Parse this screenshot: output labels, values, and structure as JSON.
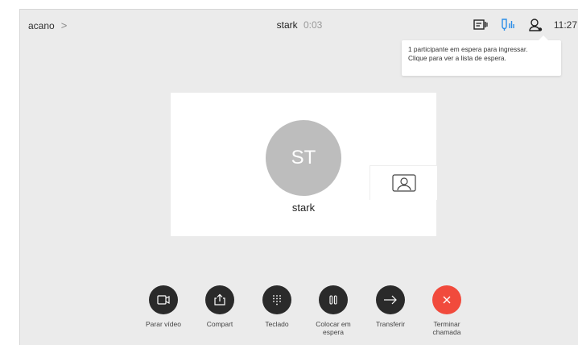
{
  "header": {
    "breadcrumb": "acano",
    "breadcrumb_chevron": ">",
    "caller": "stark",
    "duration": "0:03",
    "time": "11:27"
  },
  "tooltip": {
    "line1": "1 participante em espera para ingressar.",
    "line2": "Clique para ver a lista de espera."
  },
  "call": {
    "initials": "ST",
    "name": "stark"
  },
  "controls": [
    {
      "label": "Parar vídeo",
      "icon": "video-icon"
    },
    {
      "label": "Compart",
      "icon": "share-icon"
    },
    {
      "label": "Teclado",
      "icon": "keypad-icon"
    },
    {
      "label": "Colocar em espera",
      "icon": "pause-icon"
    },
    {
      "label": "Transferir",
      "icon": "arrow-right-icon"
    },
    {
      "label": "Terminar chamada",
      "icon": "close-icon"
    }
  ],
  "colors": {
    "background": "#ebebeb",
    "end_call": "#f14a3c",
    "accent_blue": "#2b8ee8",
    "button_dark": "#2a2a2a"
  }
}
